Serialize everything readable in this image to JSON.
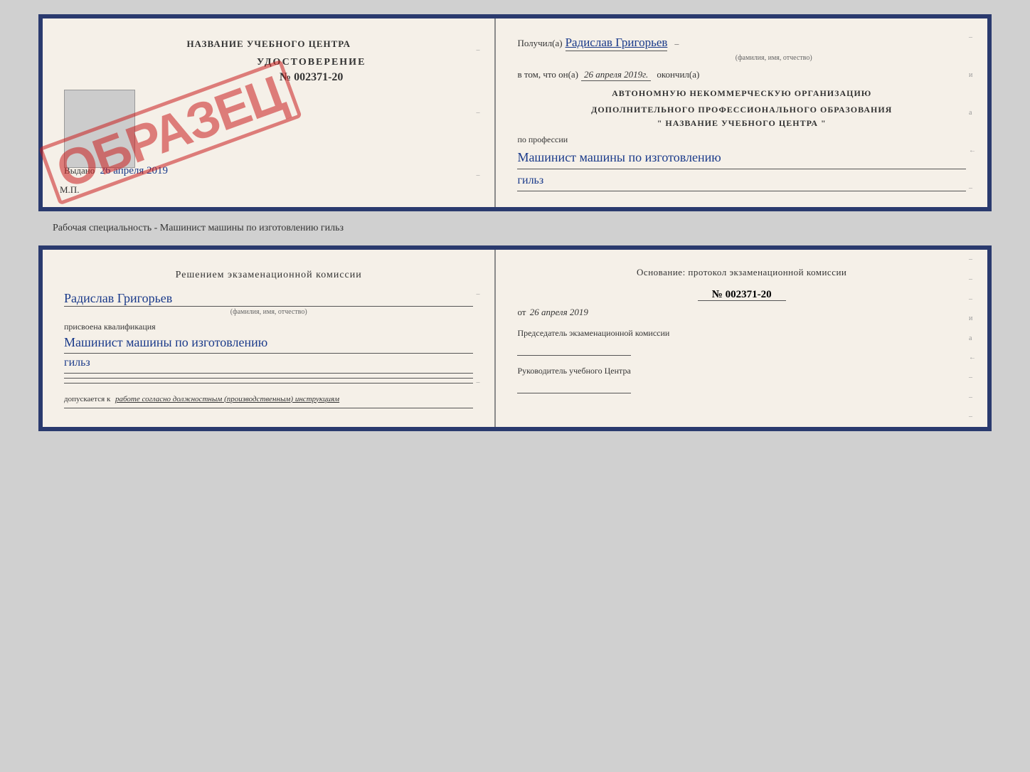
{
  "top_doc": {
    "left": {
      "header": "НАЗВАНИЕ УЧЕБНОГО ЦЕНТРА",
      "photo_area_label": "",
      "cert_title": "УДОСТОВЕРЕНИЕ",
      "cert_number": "№ 002371-20",
      "cert_issued": "Выдано",
      "cert_date": "26 апреля 2019",
      "mp_label": "М.П.",
      "obrazets": "ОБРАЗЕЦ"
    },
    "right": {
      "poluchil_label": "Получил(а)",
      "poluchil_value": "Радислав Григорьев",
      "fio_note": "(фамилия, имя, отчество)",
      "v_tom_label": "в том, что он(а)",
      "date_value": "26 апреля 2019г.",
      "okonchil_label": "окончил(а)",
      "org_line1": "АВТОНОМНУЮ НЕКОММЕРЧЕСКУЮ ОРГАНИЗАЦИЮ",
      "org_line2": "ДОПОЛНИТЕЛЬНОГО ПРОФЕССИОНАЛЬНОГО ОБРАЗОВАНИЯ",
      "org_line3": "\"  НАЗВАНИЕ УЧЕБНОГО ЦЕНТРА  \"",
      "po_professii_label": "по профессии",
      "profession_line1": "Машинист машины по изготовлению",
      "profession_line2": "гильз",
      "side_chars": [
        "–",
        "и",
        "а",
        "←",
        "–"
      ]
    }
  },
  "between_label": "Рабочая специальность - Машинист машины по изготовлению гильз",
  "bottom_doc": {
    "left": {
      "decision_label": "Решением  экзаменационной  комиссии",
      "name_value": "Радислав Григорьев",
      "fio_note": "(фамилия, имя, отчество)",
      "prisvoena_label": "присвоена квалификация",
      "qual_line1": "Машинист машины по изготовлению",
      "qual_line2": "гильз",
      "допускается_prefix": "допускается к",
      "допускается_value": "работе согласно должностным (производственным) инструкциям"
    },
    "right": {
      "osnov_label": "Основание: протокол экзаменационной  комиссии",
      "protocol_number": "№  002371-20",
      "date_label": "от",
      "date_value": "26 апреля 2019",
      "predsedatel_label": "Председатель экзаменационной комиссии",
      "rukovoditel_label": "Руководитель учебного Центра",
      "side_chars": [
        "–",
        "–",
        "–",
        "и",
        "а",
        "←",
        "–",
        "–",
        "–"
      ]
    }
  }
}
